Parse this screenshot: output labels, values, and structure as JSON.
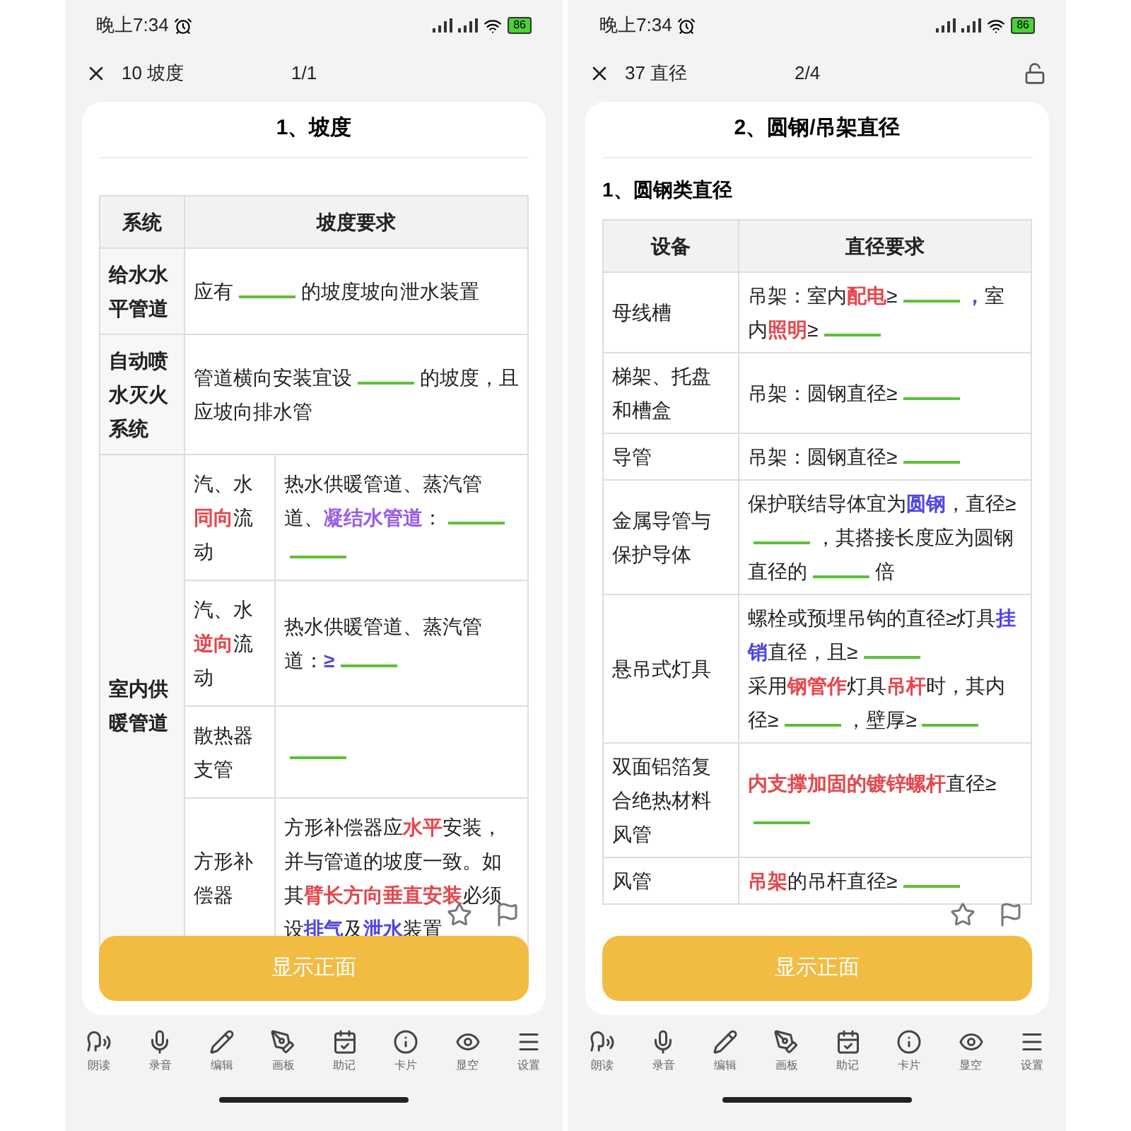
{
  "screens": [
    {
      "status_bar": {
        "time": "晚上7:34",
        "battery": "86"
      },
      "header": {
        "title": "10 坡度",
        "page": "1/1",
        "lock": false
      },
      "card": {
        "heading": "1、坡度",
        "table": {
          "columns": [
            "系统",
            "坡度要求"
          ],
          "kind": "grouped",
          "rows": [
            {
              "name": "给水水平管道",
              "requirement": [
                {
                  "kind": "text",
                  "t": "应有"
                },
                {
                  "kind": "blank"
                },
                {
                  "kind": "text",
                  "t": "的坡度坡向泄水装置"
                }
              ]
            },
            {
              "name": "自动喷水灭火系统",
              "requirement": [
                {
                  "kind": "text",
                  "t": "管道横向安装宜设"
                },
                {
                  "kind": "blank"
                },
                {
                  "kind": "text",
                  "t": "的坡度，且应坡向排水管"
                }
              ]
            },
            {
              "name": "室内供暖管道",
              "sub": [
                {
                  "name": [
                    {
                      "kind": "text",
                      "t": "汽、水"
                    },
                    {
                      "kind": "text",
                      "t": "同向",
                      "color": "#e5484d"
                    },
                    {
                      "kind": "text",
                      "t": "流动"
                    }
                  ],
                  "requirement": [
                    {
                      "kind": "text",
                      "t": "热水供暖管道、蒸汽管道、"
                    },
                    {
                      "kind": "text",
                      "t": "凝结水管道",
                      "color": "#9b5de5"
                    },
                    {
                      "kind": "text",
                      "t": "："
                    },
                    {
                      "kind": "blank"
                    },
                    {
                      "kind": "blank"
                    }
                  ]
                },
                {
                  "name": [
                    {
                      "kind": "text",
                      "t": "汽、水"
                    },
                    {
                      "kind": "text",
                      "t": "逆向",
                      "color": "#e5484d"
                    },
                    {
                      "kind": "text",
                      "t": "流动"
                    }
                  ],
                  "requirement": [
                    {
                      "kind": "text",
                      "t": "热水供暖管道、蒸汽管道："
                    },
                    {
                      "kind": "text",
                      "t": "≥",
                      "color": "#4f46e5"
                    },
                    {
                      "kind": "blank"
                    }
                  ]
                },
                {
                  "name": [
                    {
                      "kind": "text",
                      "t": "散热器支管"
                    }
                  ],
                  "requirement": [
                    {
                      "kind": "blank"
                    }
                  ]
                },
                {
                  "name": [
                    {
                      "kind": "text",
                      "t": "方形补偿器"
                    }
                  ],
                  "requirement": [
                    {
                      "kind": "text",
                      "t": "方形补偿器应"
                    },
                    {
                      "kind": "text",
                      "t": "水平",
                      "color": "#e5484d"
                    },
                    {
                      "kind": "text",
                      "t": "安装，并与管道的坡度一致。如其"
                    },
                    {
                      "kind": "text",
                      "t": "臂长方向垂直安装",
                      "color": "#e5484d"
                    },
                    {
                      "kind": "text",
                      "t": "必须设"
                    },
                    {
                      "kind": "text",
                      "t": "排气",
                      "color": "#4f46e5"
                    },
                    {
                      "kind": "text",
                      "t": "及"
                    },
                    {
                      "kind": "text",
                      "t": "泄水",
                      "color": "#4f46e5"
                    },
                    {
                      "kind": "text",
                      "t": "装置"
                    }
                  ]
                }
              ]
            }
          ]
        }
      },
      "show_button": "显示正面",
      "toolbar": [
        "朗读",
        "录音",
        "编辑",
        "画板",
        "助记",
        "卡片",
        "显空",
        "设置"
      ]
    },
    {
      "status_bar": {
        "time": "晚上7:34",
        "battery": "86"
      },
      "header": {
        "title": "37 直径",
        "page": "2/4",
        "lock": true
      },
      "card": {
        "heading": "2、圆钢/吊架直径",
        "subheading": "1、圆钢类直径",
        "table": {
          "columns": [
            "设备",
            "直径要求"
          ],
          "kind": "simple",
          "rows": [
            {
              "name": "母线槽",
              "requirement": [
                {
                  "kind": "text",
                  "t": "吊架：室内"
                },
                {
                  "kind": "text",
                  "t": "配电",
                  "color": "#e5484d"
                },
                {
                  "kind": "text",
                  "t": "≥"
                },
                {
                  "kind": "blank"
                },
                {
                  "kind": "text",
                  "t": "，",
                  "color": "#4f46e5"
                },
                {
                  "kind": "text",
                  "t": "室内"
                },
                {
                  "kind": "text",
                  "t": "照明",
                  "color": "#e5484d"
                },
                {
                  "kind": "text",
                  "t": "≥"
                },
                {
                  "kind": "blank"
                }
              ]
            },
            {
              "name": "梯架、托盘和槽盒",
              "requirement": [
                {
                  "kind": "text",
                  "t": "吊架：圆钢直径≥"
                },
                {
                  "kind": "blank"
                }
              ]
            },
            {
              "name": "导管",
              "requirement": [
                {
                  "kind": "text",
                  "t": "吊架：圆钢直径≥"
                },
                {
                  "kind": "blank"
                }
              ]
            },
            {
              "name": "金属导管与保护导体",
              "requirement": [
                {
                  "kind": "text",
                  "t": "保护联结导体宜为"
                },
                {
                  "kind": "text",
                  "t": "圆钢",
                  "color": "#4f46e5"
                },
                {
                  "kind": "text",
                  "t": "，直径≥"
                },
                {
                  "kind": "blank"
                },
                {
                  "kind": "text",
                  "t": "，其搭接长度应为圆钢直径的"
                },
                {
                  "kind": "blank"
                },
                {
                  "kind": "text",
                  "t": "倍"
                }
              ]
            },
            {
              "name": "悬吊式灯具",
              "requirement": [
                {
                  "kind": "text",
                  "t": "螺栓或预埋吊钩的直径≥灯具"
                },
                {
                  "kind": "text",
                  "t": "挂销",
                  "color": "#4f46e5"
                },
                {
                  "kind": "text",
                  "t": "直径，且≥"
                },
                {
                  "kind": "blank"
                },
                {
                  "kind": "break"
                },
                {
                  "kind": "text",
                  "t": "采用"
                },
                {
                  "kind": "text",
                  "t": "钢管作",
                  "color": "#e5484d"
                },
                {
                  "kind": "text",
                  "t": "灯具"
                },
                {
                  "kind": "text",
                  "t": "吊杆",
                  "color": "#e5484d"
                },
                {
                  "kind": "text",
                  "t": "时，其内径≥"
                },
                {
                  "kind": "blank"
                },
                {
                  "kind": "text",
                  "t": "，壁厚≥"
                },
                {
                  "kind": "blank"
                }
              ]
            },
            {
              "name": "双面铝箔复合绝热材料风管",
              "requirement": [
                {
                  "kind": "text",
                  "t": "内支撑加固的镀锌螺杆",
                  "color": "#e5484d"
                },
                {
                  "kind": "text",
                  "t": "直径≥"
                },
                {
                  "kind": "blank"
                }
              ]
            },
            {
              "name": "风管",
              "requirement": [
                {
                  "kind": "text",
                  "t": "吊架",
                  "color": "#e5484d"
                },
                {
                  "kind": "text",
                  "t": "的吊杆直径≥"
                },
                {
                  "kind": "blank"
                }
              ]
            }
          ]
        }
      },
      "show_button": "显示正面",
      "toolbar": [
        "朗读",
        "录音",
        "编辑",
        "画板",
        "助记",
        "卡片",
        "显空",
        "设置"
      ]
    }
  ]
}
